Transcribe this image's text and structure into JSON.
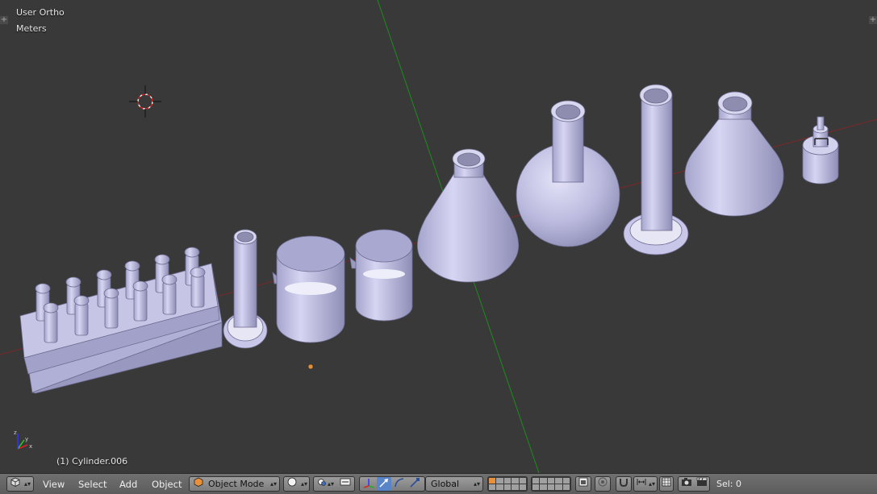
{
  "viewport": {
    "view_name": "User Ortho",
    "units": "Meters",
    "active_object": "(1) Cylinder.006",
    "axis_labels": {
      "x": "x",
      "y": "y",
      "z": "z"
    }
  },
  "header": {
    "menus": [
      "View",
      "Select",
      "Add",
      "Object"
    ],
    "mode": "Object Mode",
    "orientation": "Global",
    "selection": "Sel: 0"
  },
  "icons": {
    "editor_type": "cube-icon",
    "viewport_shading": "sphere-solid-icon",
    "pivot": "pivot-point-icon",
    "manipulator_toggle": "axis-manipulator-icon",
    "translate": "translate-arrow-icon",
    "rotate": "rotate-arc-icon",
    "scale": "scale-arrow-icon",
    "snap": "magnet-icon",
    "render": "camera-icon",
    "render_anim": "clapper-icon"
  },
  "colors": {
    "viewport_bg": "#393939",
    "x_axis": "#8a2d2d",
    "y_axis": "#1a8a1a",
    "object": "#b3b2d8",
    "header": "#6b6b6b"
  }
}
